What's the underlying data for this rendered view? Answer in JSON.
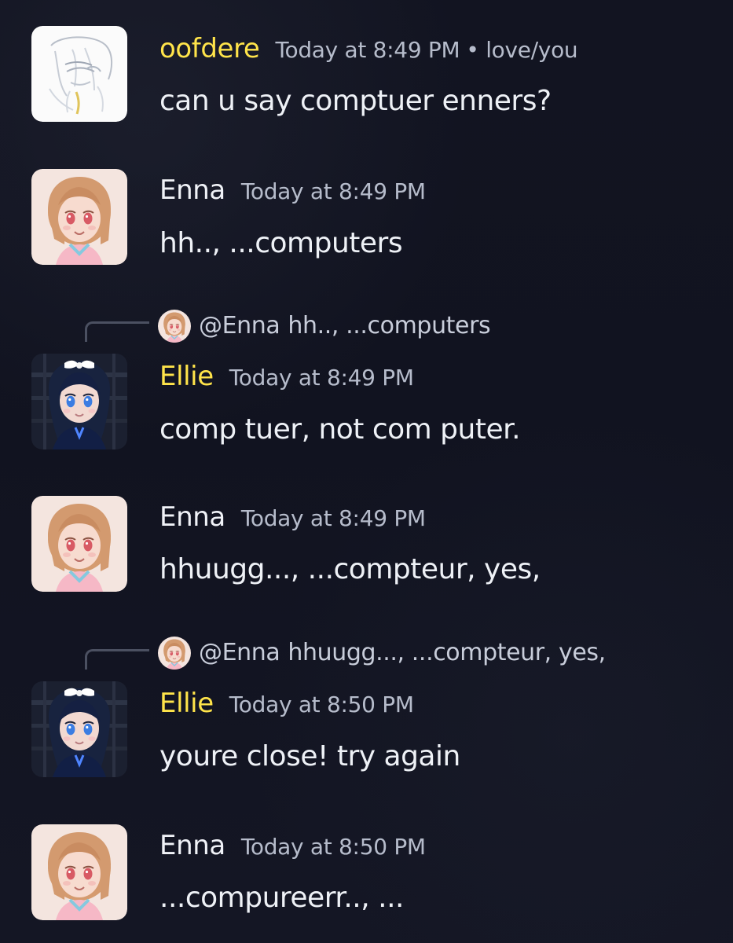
{
  "messages": [
    {
      "author": "oofdere",
      "author_color": "#ffe44a",
      "avatar_icon": "sketch-avatar-icon",
      "timestamp": "Today at 8:49 PM",
      "channel_suffix": "• love/you",
      "text": "can u say comptuer enners?"
    },
    {
      "author": "Enna",
      "author_color": "#f0f2f7",
      "avatar_icon": "enna-avatar-icon",
      "timestamp": "Today at 8:49 PM",
      "text": "hh.., ...computers"
    },
    {
      "reply": {
        "mention": "@Enna",
        "text": "hh.., ...computers",
        "avatar_icon": "enna-mini-avatar-icon"
      },
      "author": "Ellie",
      "author_color": "#ffe44a",
      "avatar_icon": "ellie-avatar-icon",
      "timestamp": "Today at 8:49 PM",
      "text": "comp tuer, not com puter."
    },
    {
      "author": "Enna",
      "author_color": "#f0f2f7",
      "avatar_icon": "enna-avatar-icon",
      "timestamp": "Today at 8:49 PM",
      "text": "hhuugg..., ...compteur, yes,"
    },
    {
      "reply": {
        "mention": "@Enna",
        "text": "hhuugg..., ...compteur, yes,",
        "avatar_icon": "enna-mini-avatar-icon"
      },
      "author": "Ellie",
      "author_color": "#ffe44a",
      "avatar_icon": "ellie-avatar-icon",
      "timestamp": "Today at 8:50 PM",
      "text": "youre close! try again"
    },
    {
      "author": "Enna",
      "author_color": "#f0f2f7",
      "avatar_icon": "enna-avatar-icon",
      "timestamp": "Today at 8:50 PM",
      "text": "...compureerr.., ..."
    }
  ]
}
